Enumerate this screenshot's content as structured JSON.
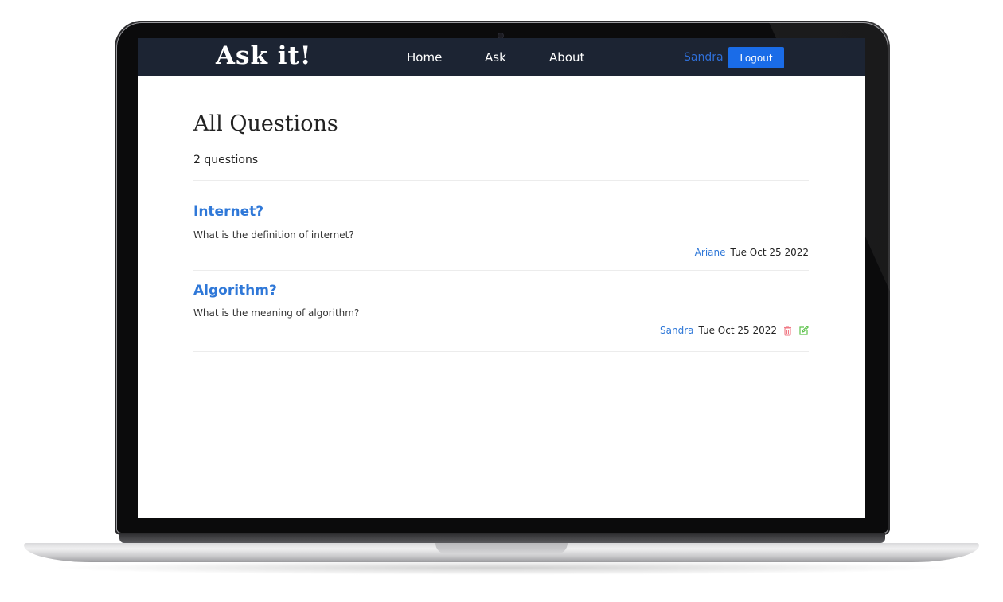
{
  "app": {
    "brand": "Ask it!",
    "nav": [
      "Home",
      "Ask",
      "About"
    ],
    "current_user": "Sandra",
    "logout_label": "Logout"
  },
  "main": {
    "title": "All Questions",
    "count_text": "2 questions",
    "questions": [
      {
        "title": "Internet?",
        "body": "What is the definition of internet?",
        "author": "Ariane",
        "date": "Tue Oct 25 2022",
        "owned": false
      },
      {
        "title": "Algorithm?",
        "body": "What is the meaning of algorithm?",
        "author": "Sandra",
        "date": "Tue Oct 25 2022",
        "owned": true
      }
    ]
  },
  "colors": {
    "navbar": "#1c2433",
    "accent": "#2f78d8",
    "logout_button": "#1a6ce8",
    "delete_icon": "#f07a86",
    "edit_icon": "#5cc24a"
  },
  "icons": {
    "delete": "trash-icon",
    "edit": "edit-icon"
  }
}
